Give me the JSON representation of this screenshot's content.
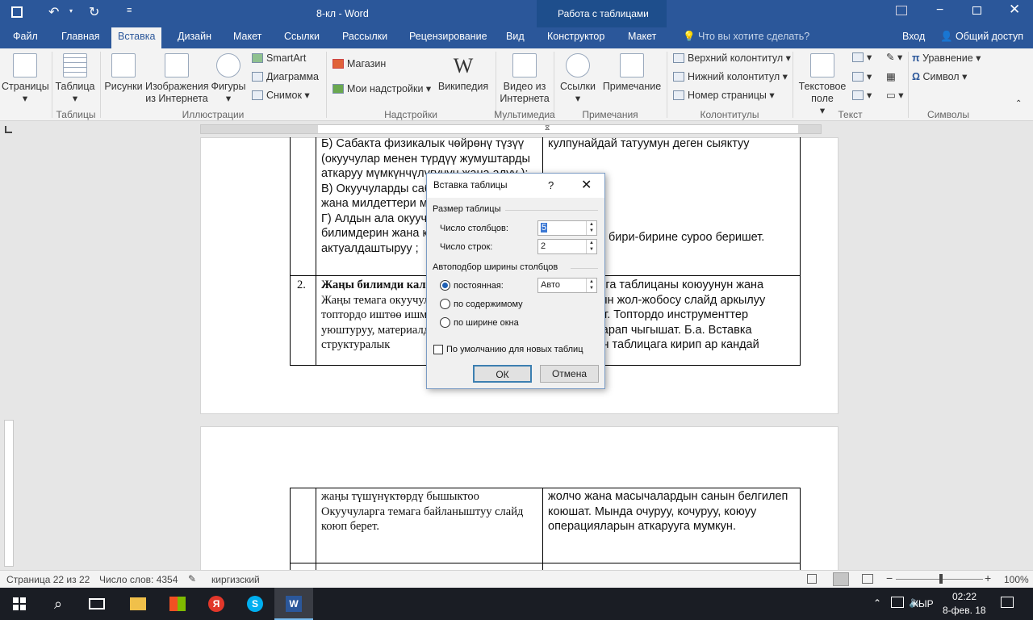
{
  "titlebar": {
    "doc_title": "8-кл - Word",
    "context_title": "Работа с таблицами"
  },
  "tabs": [
    "Файл",
    "Главная",
    "Вставка",
    "Дизайн",
    "Макет",
    "Ссылки",
    "Рассылки",
    "Рецензирование",
    "Вид",
    "Конструктор",
    "Макет"
  ],
  "tellme": "Что вы хотите сделать?",
  "signin": "Вход",
  "share": "Общий доступ",
  "ribbon": {
    "pages": "Страницы",
    "table": "Таблица",
    "pictures": "Рисунки",
    "online_pictures": "Изображения из Интернета",
    "shapes": "Фигуры",
    "smartart": "SmartArt",
    "chart": "Диаграмма",
    "screenshot": "Снимок",
    "store": "Магазин",
    "my_addins": "Мои надстройки",
    "wikipedia": "Википедия",
    "online_video": "Видео из Интернета",
    "links": "Ссылки",
    "comment": "Примечание",
    "header": "Верхний колонтитул",
    "footer": "Нижний колонтитул",
    "page_number": "Номер страницы",
    "textbox": "Текстовое поле",
    "equation": "Уравнение",
    "symbol": "Символ",
    "groups": {
      "tables": "Таблицы",
      "illustrations": "Иллюстрации",
      "addins": "Надстройки",
      "multimedia": "Мультимедиа",
      "comments": "Примечания",
      "header_footer": "Колонтитулы",
      "text": "Текст",
      "symbols": "Символы"
    }
  },
  "doc": {
    "p1_left": "Б) Сабакта физикалык чөйрөнү түзүү (окуучулар менен түрдүү жумуштарды аткаруу мүмкүнчүлүгүнүн жана алуу );\nВ) Окуучуларды сабактын максаты жана милдеттери менен тааныштыруу ;\nГ) Алдын ала окуучулардын билимдерин жана көндүмдөрүн актуалдаштыруу ;",
    "p1_right_top": "кулпунайдай татуумун деген сыяктуу",
    "p1_right_mid": "бири-бирине суроо беришет.",
    "row2_num": "2.",
    "row2_left_bold": "Жаңы билимди калыптандыруу этабы:",
    "row2_left": "Жаңы темага окуучуларды эки-экиден, топтордо иштөө ишмердүүлүгүн уюштуруу, материалдарды угуу, структуралык",
    "row2_right": "Окуучуларга таблицаны коюуунун жана таблицанын жол-жобосу слайд аркылуу көрсөтүлөт. Топтордо инструменттер панелин карап чыгышат. Б.а. Вставка менюсунан таблицага кирип ар кандай",
    "p2_left": "жаңы түшүнүктөрдү бышыктоо Окуучуларга темага байланыштуу слайд коюп берет.",
    "p2_right": "жолчо жана масычалардын санын белгилеп коюшат. Мында очуруу, кочуруу, коюуу операцияларын аткарууга мумкун."
  },
  "dialog": {
    "title": "Вставка таблицы",
    "help": "?",
    "size_group": "Размер таблицы",
    "cols_label": "Число столбцов:",
    "cols_value": "5",
    "rows_label": "Число строк:",
    "rows_value": "2",
    "autofit_group": "Автоподбор ширины столбцов",
    "fixed": "постоянная:",
    "fixed_value": "Авто",
    "contents": "по содержимому",
    "window": "по ширине окна",
    "default": "По умолчанию для новых таблиц",
    "ok": "ОК",
    "cancel": "Отмена"
  },
  "status": {
    "page": "Страница 22 из 22",
    "words": "Число слов: 4354",
    "lang": "киргизский",
    "zoom": "100%"
  },
  "taskbar": {
    "lang": "КЫР",
    "time": "02:22",
    "date": "8-фев. 18"
  },
  "colors": {
    "accent": "#2b579a",
    "context": "#1e4e8c"
  }
}
